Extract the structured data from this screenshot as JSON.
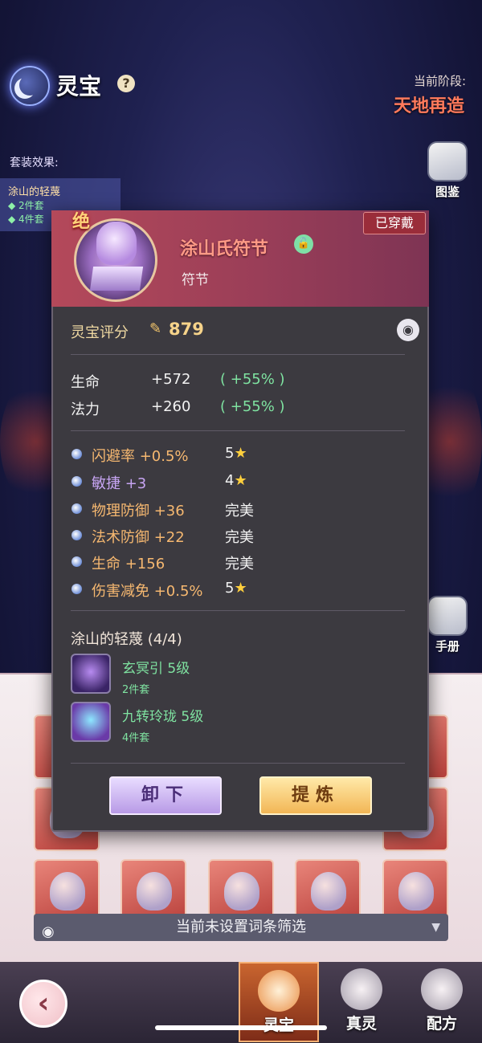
{
  "header": {
    "title": "灵宝",
    "help": "?",
    "stage_label": "当前阶段:",
    "stage_value": "天地再造"
  },
  "set_effects": {
    "title": "套装效果:",
    "set_name": "涂山的轻蔑",
    "row2": "◆ 2件套",
    "row3": "◆ 4件套"
  },
  "side_buttons": {
    "codex": "图鉴",
    "manual": "手册"
  },
  "popup": {
    "grade": "绝",
    "item_name": "涂山氏符节",
    "item_type": "符节",
    "equipped": "已穿戴",
    "score_label": "灵宝评分",
    "score_value": "879",
    "base_stats": [
      {
        "name": "生命",
        "value": "+572",
        "pct": "( +55% )"
      },
      {
        "name": "法力",
        "value": "+260",
        "pct": "( +55% )"
      }
    ],
    "affixes": [
      {
        "text": "闪避率 +0.5%",
        "rank": "5",
        "star": true,
        "color": "orange"
      },
      {
        "text": "敏捷 +3",
        "rank": "4",
        "star": true,
        "color": "purple"
      },
      {
        "text": "物理防御 +36",
        "rank": "完美",
        "star": false,
        "color": "orange"
      },
      {
        "text": "法术防御 +22",
        "rank": "完美",
        "star": false,
        "color": "orange"
      },
      {
        "text": "生命 +156",
        "rank": "完美",
        "star": false,
        "color": "orange"
      },
      {
        "text": "伤害减免 +0.5%",
        "rank": "5",
        "star": true,
        "color": "orange"
      }
    ],
    "set": {
      "name": "涂山的轻蔑 (4/4)",
      "items": [
        {
          "name": "玄冥引 5级",
          "sub": "2件套"
        },
        {
          "name": "九转玲珑 5级",
          "sub": "4件套"
        }
      ]
    },
    "unequip_button": "卸下",
    "refine_button": "提炼"
  },
  "filter_bar": {
    "label": "当前未设置词条筛选",
    "arrow": "▼"
  },
  "bottom_nav": {
    "back": "‹",
    "tabs": [
      "灵宝",
      "真灵",
      "配方"
    ]
  },
  "colors": {
    "accent_red": "#ff7a5c",
    "green": "#7fe3a1",
    "orange": "#f6b870",
    "purple": "#c7a5f3"
  }
}
